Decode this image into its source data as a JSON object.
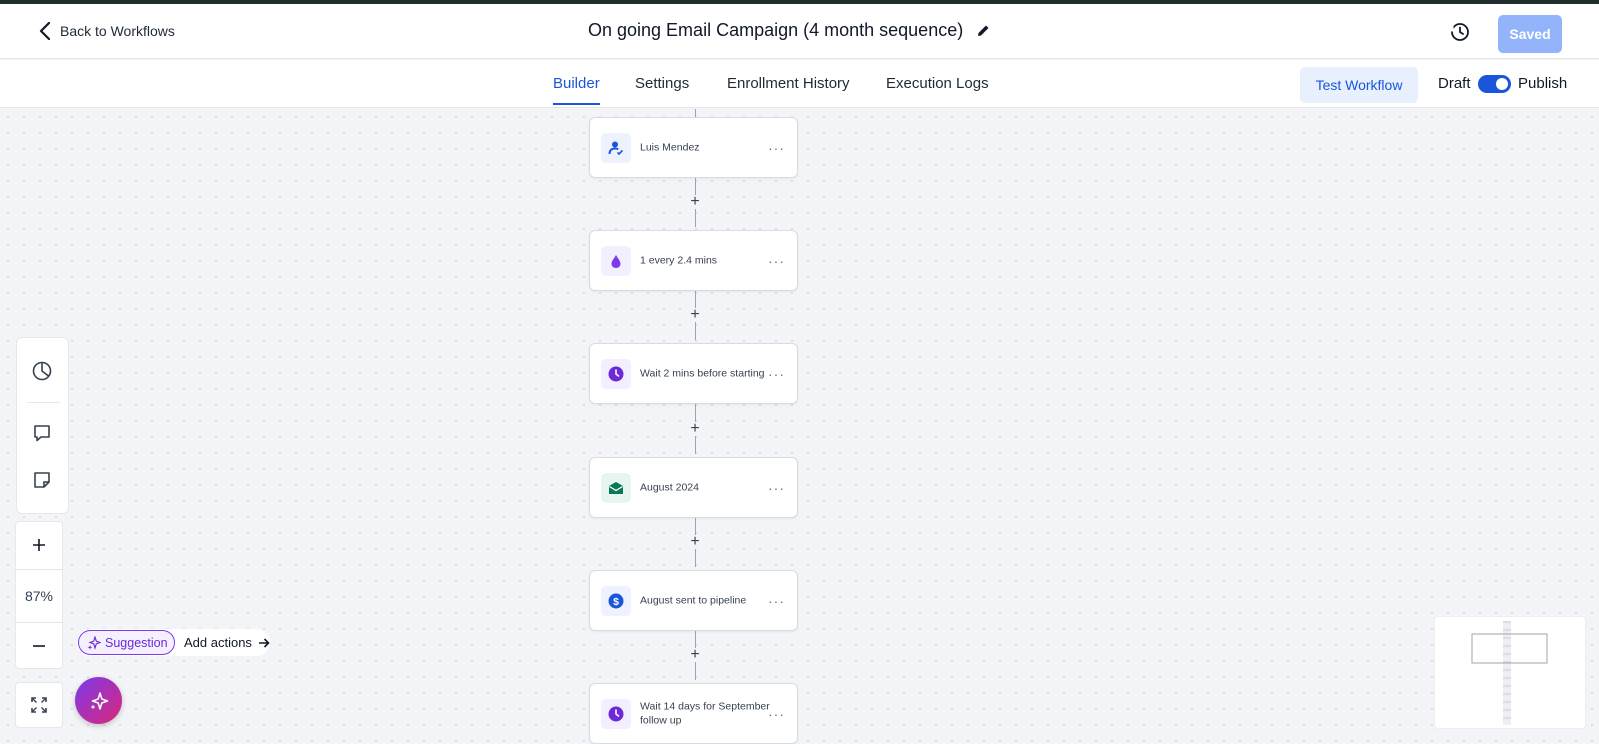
{
  "header": {
    "back_label": "Back to Workflows",
    "title": "On going Email Campaign (4 month sequence)",
    "saved_label": "Saved"
  },
  "tabs": [
    {
      "label": "Builder",
      "active": true
    },
    {
      "label": "Settings",
      "active": false
    },
    {
      "label": "Enrollment History",
      "active": false
    },
    {
      "label": "Execution Logs",
      "active": false
    }
  ],
  "actions": {
    "test_workflow": "Test Workflow",
    "draft_label": "Draft",
    "publish_label": "Publish",
    "publish_toggle_on": true
  },
  "nodes": [
    {
      "label": "Luis Mendez",
      "icon": "user-check-icon",
      "icon_color": "#1a56db",
      "icon_bg": "#eef2ff"
    },
    {
      "label": "1 every 2.4 mins",
      "icon": "drip-icon",
      "icon_color": "#7c3aed",
      "icon_bg": "#f3efff"
    },
    {
      "label": "Wait 2 mins before starting",
      "icon": "clock-icon",
      "icon_color": "#6d28d9",
      "icon_bg": "#f3efff"
    },
    {
      "label": "August 2024",
      "icon": "email-icon",
      "icon_color": "#047857",
      "icon_bg": "#e6f6ef"
    },
    {
      "label": "August sent to pipeline",
      "icon": "dollar-icon",
      "icon_color": "#1a56db",
      "icon_bg": "#eef2ff"
    },
    {
      "label": "Wait 14 days for September follow up",
      "icon": "clock-icon",
      "icon_color": "#6d28d9",
      "icon_bg": "#f3efff"
    }
  ],
  "zoom": {
    "level": "87%"
  },
  "suggestion": {
    "pill_label": "Suggestion",
    "action_label": "Add actions"
  },
  "colors": {
    "accent": "#1a56db",
    "saved_bg": "#93b4fb",
    "magic_gradient_start": "#7c3aed",
    "magic_gradient_end": "#db2777"
  }
}
